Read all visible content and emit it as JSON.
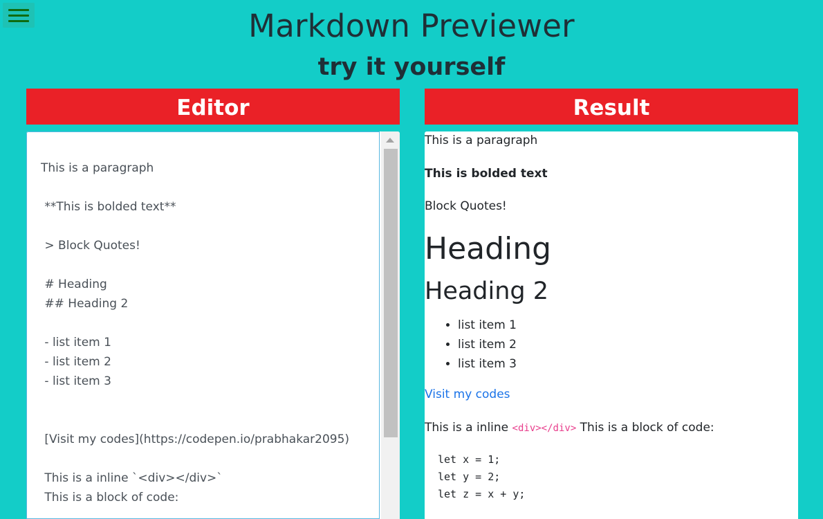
{
  "header": {
    "title": "Markdown Previewer",
    "subtitle": "try it yourself",
    "menu_icon": "hamburger-menu-icon"
  },
  "editor": {
    "title": "Editor",
    "content": "This is a paragraph\n\n **This is bolded text**\n\n > Block Quotes!\n\n # Heading\n ## Heading 2\n\n - list item 1\n - list item 2\n - list item 3\n\n\n [Visit my codes](https://codepen.io/prabhakar2095)\n\n This is a inline `<div></div>`\n This is a block of code:"
  },
  "result": {
    "title": "Result",
    "paragraph": "This is a paragraph",
    "bold": "This is bolded text",
    "quote": "Block Quotes!",
    "heading1": "Heading",
    "heading2": "Heading 2",
    "list": [
      "list item 1",
      "list item 2",
      "list item 3"
    ],
    "link": "Visit my codes",
    "inline_before": "This is a inline ",
    "inline_code": "<div></div>",
    "inline_after": " This is a block of code:",
    "code_block": "let x = 1;\nlet y = 2;\nlet z = x + y;"
  },
  "colors": {
    "background": "#13cdc8",
    "header_bar": "#ea2127",
    "menu_icon": "#0f6b0f",
    "link": "#1a73e8",
    "inline_code": "#e83e8c"
  }
}
